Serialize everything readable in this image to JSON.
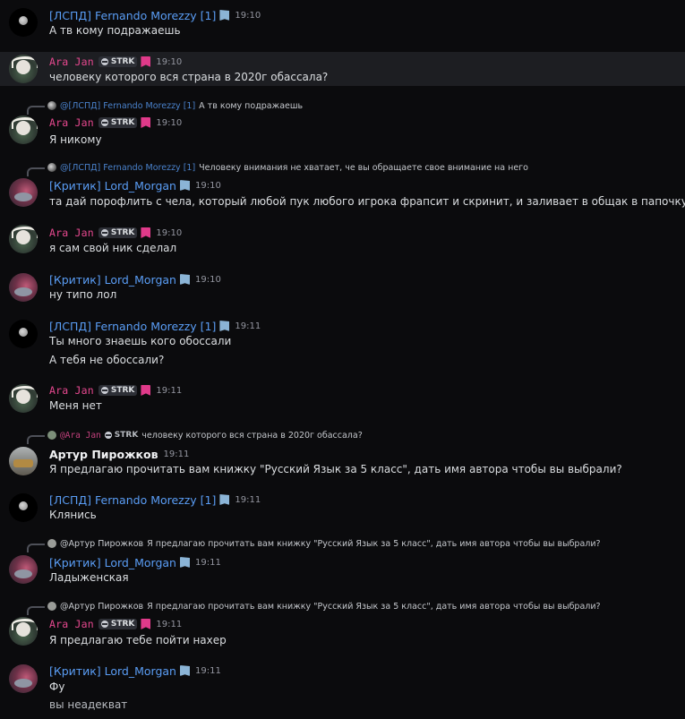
{
  "colors": {
    "background": "#0b0b0d",
    "highlight_row": "#1d1e22",
    "blue_name": "#5a9df5",
    "pink_name": "#e6488f",
    "timestamp": "#9496a0",
    "text": "#dbdee1"
  },
  "icons": {
    "badge_book": "book-badge-icon",
    "badge_pink": "bookmark-badge-icon",
    "skull": "skull-icon"
  },
  "messages": [
    {
      "author": "[ЛСПД] Fernando Morezzy [1]",
      "time": "19:10",
      "lines": [
        "А тв кому подражаешь"
      ]
    },
    {
      "author": "Ara Jan",
      "tag": "STRK",
      "time": "19:10",
      "lines": [
        "человеку которого вся страна в 2020г обассала?"
      ]
    },
    {
      "reply": {
        "name": "@[ЛСПД] Fernando Morezzy [1]",
        "text": "А тв кому подражаешь"
      },
      "author": "Ara Jan",
      "tag": "STRK",
      "time": "19:10",
      "lines": [
        "Я никому"
      ]
    },
    {
      "reply": {
        "name": "@[ЛСПД] Fernando Morezzy [1]",
        "text": "Человеку внимания не хватает, че вы обращаете свое внимание на него"
      },
      "author": "[Критик] Lord_Morgan",
      "time": "19:10",
      "lines": [
        "та дай порофлить с чела, который любой пук любого игрока фрапсит и скринит, и заливает в общак в папочку на яндекс-диск"
      ]
    },
    {
      "author": "Ara Jan",
      "tag": "STRK",
      "time": "19:10",
      "lines": [
        "я сам свой ник сделал"
      ]
    },
    {
      "author": "[Критик] Lord_Morgan",
      "time": "19:10",
      "lines": [
        "ну типо лол"
      ]
    },
    {
      "author": "[ЛСПД] Fernando Morezzy [1]",
      "time": "19:11",
      "lines": [
        "Ты много знаешь кого обоссали",
        "А тебя не обоссали?"
      ]
    },
    {
      "author": "Ara Jan",
      "tag": "STRK",
      "time": "19:11",
      "lines": [
        "Меня нет"
      ]
    },
    {
      "reply": {
        "name": "@Ara Jan",
        "tag": "STRK",
        "text": "человеку которого вся страна в 2020г обассала?"
      },
      "author": "Артур Пирожков",
      "time": "19:11",
      "lines": [
        "Я предлагаю прочитать вам книжку \"Русский Язык за 5 класс\", дать имя автора чтобы вы выбрали?"
      ]
    },
    {
      "author": "[ЛСПД] Fernando Morezzy [1]",
      "time": "19:11",
      "lines": [
        "Клянись"
      ]
    },
    {
      "reply": {
        "name": "@Артур Пирожков",
        "text": "Я предлагаю прочитать вам книжку \"Русский Язык за 5 класс\", дать имя автора чтобы вы выбрали?"
      },
      "author": "[Критик] Lord_Morgan",
      "time": "19:11",
      "lines": [
        "Ладыженская"
      ]
    },
    {
      "reply": {
        "name": "@Артур Пирожков",
        "text": "Я предлагаю прочитать вам книжку \"Русский Язык за 5 класс\", дать имя автора чтобы вы выбрали?"
      },
      "author": "Ara Jan",
      "tag": "STRK",
      "time": "19:11",
      "lines": [
        "Я предлагаю тебе пойти нахер"
      ]
    },
    {
      "author": "[Критик] Lord_Morgan",
      "time": "19:11",
      "lines": [
        "Фу",
        "вы неадекват"
      ]
    }
  ]
}
